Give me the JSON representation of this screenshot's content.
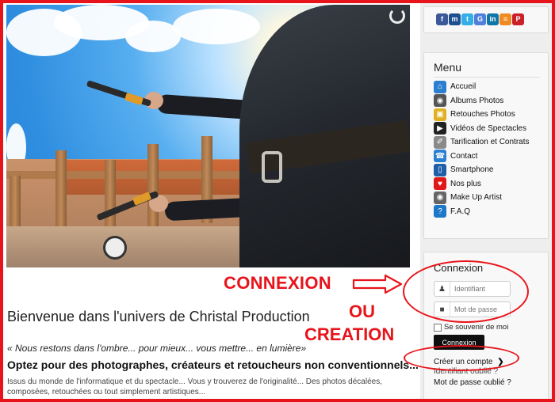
{
  "hero": {
    "alt": ""
  },
  "annotations": {
    "connexion": "CONNEXION",
    "ou": "OU",
    "creation": "CREATION",
    "color": "#e8141b"
  },
  "main": {
    "title": "Bienvenue dans l'univers de Christal Production",
    "quote": "« Nous restons dans l'ombre... pour mieux... vous mettre... en lumière»",
    "subtitle": "Optez pour des photographes, créateurs et retoucheurs non conventionnels...",
    "intro": "Issus du monde de l'informatique et du spectacle... Vous y trouverez de l'originalité... Des photos décalées, composées, retouchées ou tout simplement artistiques..."
  },
  "social": [
    {
      "icon": "facebook-icon",
      "glyph": "f",
      "color": "#3b5998"
    },
    {
      "icon": "myspace-icon",
      "glyph": "m",
      "color": "#1d4f91"
    },
    {
      "icon": "twitter-icon",
      "glyph": "t",
      "color": "#33aee8"
    },
    {
      "icon": "google-icon",
      "glyph": "G",
      "color": "#4f7fd9"
    },
    {
      "icon": "linkedin-icon",
      "glyph": "in",
      "color": "#0e76a8"
    },
    {
      "icon": "rss-icon",
      "glyph": "≡",
      "color": "#f08a24"
    },
    {
      "icon": "pinterest-icon",
      "glyph": "P",
      "color": "#cb2027"
    }
  ],
  "menu": {
    "title": "Menu",
    "items": [
      {
        "label": "Accueil",
        "icon": "home-icon",
        "glyph": "⌂",
        "color": "#2b7fd0"
      },
      {
        "label": "Albums Photos",
        "icon": "camera-icon",
        "glyph": "◉",
        "color": "#555555"
      },
      {
        "label": "Retouches Photos",
        "icon": "photo-edit-icon",
        "glyph": "▣",
        "color": "#e0b020"
      },
      {
        "label": "Vidéos de Spectacles",
        "icon": "video-icon",
        "glyph": "▶",
        "color": "#222222"
      },
      {
        "label": "Tarification et Contrats",
        "icon": "tag-icon",
        "glyph": "✐",
        "color": "#8a8a8a"
      },
      {
        "label": "Contact",
        "icon": "contact-icon",
        "glyph": "☎",
        "color": "#2b7fd0"
      },
      {
        "label": "Smartphone",
        "icon": "smartphone-icon",
        "glyph": "▯",
        "color": "#1f5fa8"
      },
      {
        "label": "Nos plus",
        "icon": "heart-icon",
        "glyph": "♥",
        "color": "#e01818"
      },
      {
        "label": "Make Up Artist",
        "icon": "eye-icon",
        "glyph": "◉",
        "color": "#666666"
      },
      {
        "label": "F.A.Q",
        "icon": "help-icon",
        "glyph": "?",
        "color": "#1e78c8"
      }
    ]
  },
  "login": {
    "title": "Connexion",
    "username_placeholder": "Identifiant",
    "password_placeholder": "Mot de passe",
    "remember_label": "Se souvenir de moi",
    "submit_label": "Connexion",
    "create_account": "Créer un compte",
    "forgot_username": "Identifiant oublié ?",
    "forgot_password": "Mot de passe oublié ?"
  }
}
